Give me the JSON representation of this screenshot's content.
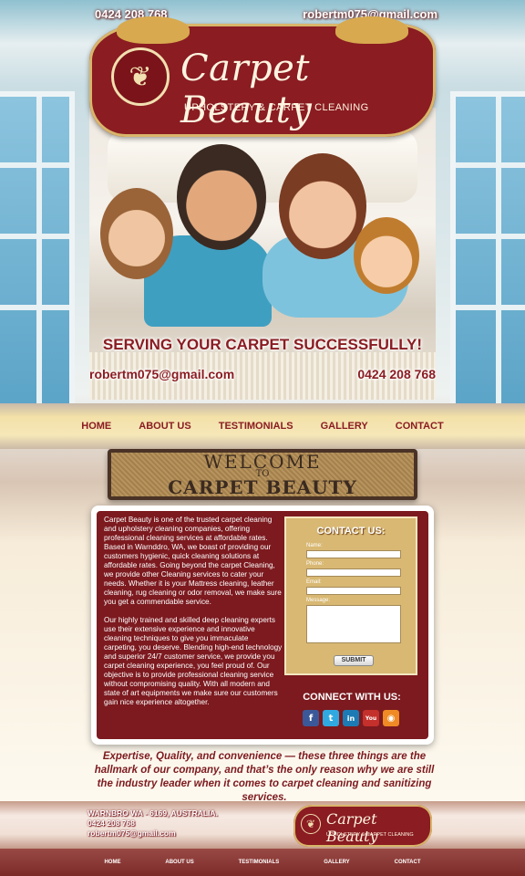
{
  "header": {
    "phone": "0424 208 768",
    "email": "robertm075@gmail.com"
  },
  "logo": {
    "brand": "Carpet Beauty",
    "tagline": "UPHOLSTERY & CARPET CLEANING"
  },
  "hero": {
    "slogan": "SERVING YOUR CARPET SUCCESSFULLY!",
    "email": "robertm075@gmail.com",
    "phone": "0424 208 768"
  },
  "nav": {
    "items": [
      "HOME",
      "ABOUT US",
      "TESTIMONIALS",
      "GALLERY",
      "CONTACT"
    ]
  },
  "welcome": {
    "line1": "WELCOME",
    "line2": "TO",
    "line3": "CARPET BEAUTY"
  },
  "about": {
    "paragraph1": "Carpet Beauty is one of the trusted carpet cleaning and upholstery cleaning companies, offering professional cleaning services at affordable rates. Based in Warnddro, WA, we boast of providing our customers hygienic, quick cleaning solutions at affordable rates. Going beyond the carpet Cleaning, we provide other Cleaning services to cater your needs. Whether it is your Mattress cleaning, leather cleaning, rug cleaning or odor removal, we make sure you get a commendable service.",
    "paragraph2": "Our highly trained and skilled deep cleaning experts use their extensive experience and innovative cleaning techniques to give you immaculate carpeting, you deserve. Blending high-end technology and superior 24/7 customer service, we provide you carpet cleaning experience, you feel proud of. Our objective is to provide professional cleaning service without compromising quality. With all modern and state of art equipments we make sure our customers gain nice experience altogether."
  },
  "contact_form": {
    "title": "CONTACT US:",
    "name_label": "Name:",
    "phone_label": "Phone:",
    "email_label": "Email:",
    "message_label": "Message:",
    "submit_label": "SUBMIT"
  },
  "connect": {
    "title": "CONNECT WITH US:",
    "icons": [
      {
        "name": "facebook-icon",
        "glyph": "f",
        "color": "#3b5998"
      },
      {
        "name": "twitter-icon",
        "glyph": "t",
        "color": "#2fa9e0"
      },
      {
        "name": "linkedin-icon",
        "glyph": "in",
        "color": "#1c7bb4"
      },
      {
        "name": "youtube-icon",
        "glyph": "You",
        "color": "#c4302b"
      },
      {
        "name": "rss-icon",
        "glyph": "◉",
        "color": "#f08a24"
      }
    ]
  },
  "hallmark": "Expertise, Quality, and convenience — these three things are the hallmark of our company, and that’s the only reason why we are still the industry leader when it comes to carpet cleaning and sanitizing services.",
  "footer": {
    "address": "WARNBRO WA - 6169, AUSTRALIA.",
    "phone": "0424 208 768",
    "email": "robertm075@gmail.com",
    "logo_brand": "Carpet Beauty",
    "logo_tagline": "UPHOLSTERY & CARPET CLEANING",
    "nav": [
      "HOME",
      "ABOUT US",
      "TESTIMONIALS",
      "GALLERY",
      "CONTACT"
    ]
  },
  "colors": {
    "brand_maroon": "#7c1a1f",
    "gold": "#d8b873"
  }
}
